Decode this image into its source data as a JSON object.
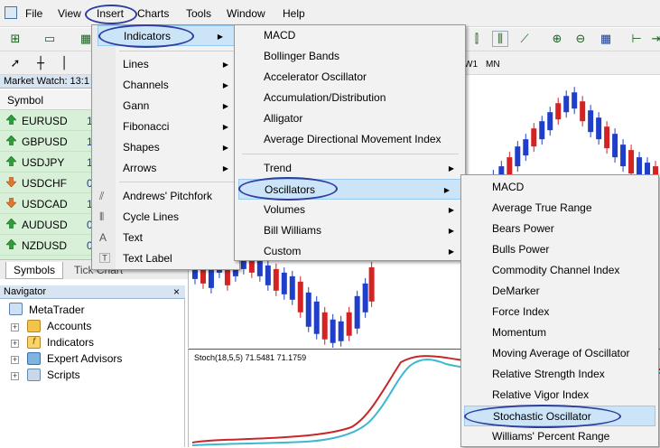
{
  "menubar": {
    "items": [
      "File",
      "View",
      "Insert",
      "Charts",
      "Tools",
      "Window",
      "Help"
    ]
  },
  "timeframes": [
    "W1",
    "MN"
  ],
  "market_watch": {
    "title": "Market Watch: 13:1",
    "column_symbol": "Symbol",
    "rows": [
      {
        "symbol": "EURUSD",
        "bid": "1",
        "dir": "up"
      },
      {
        "symbol": "GBPUSD",
        "bid": "1",
        "dir": "up"
      },
      {
        "symbol": "USDJPY",
        "bid": "1",
        "dir": "up"
      },
      {
        "symbol": "USDCHF",
        "bid": "0",
        "dir": "down"
      },
      {
        "symbol": "USDCAD",
        "bid": "1",
        "dir": "down"
      },
      {
        "symbol": "AUDUSD",
        "bid": "0",
        "dir": "up"
      },
      {
        "symbol": "NZDUSD",
        "bid": "0",
        "dir": "up"
      },
      {
        "symbol": "EURJPY",
        "bid": "1",
        "dir": "down"
      }
    ],
    "tabs": [
      "Symbols",
      "Tick Chart"
    ]
  },
  "navigator": {
    "title": "Navigator",
    "close": "×",
    "root": "MetaTrader",
    "items": [
      "Accounts",
      "Indicators",
      "Expert Advisors",
      "Scripts"
    ]
  },
  "insert_menu": {
    "items": [
      {
        "label": "Indicators",
        "submenu": true
      },
      {
        "label": "Lines",
        "submenu": true
      },
      {
        "label": "Channels",
        "submenu": true
      },
      {
        "label": "Gann",
        "submenu": true
      },
      {
        "label": "Fibonacci",
        "submenu": true
      },
      {
        "label": "Shapes",
        "submenu": true
      },
      {
        "label": "Arrows",
        "submenu": true
      },
      {
        "label": "Andrews' Pitchfork",
        "submenu": false
      },
      {
        "label": "Cycle Lines",
        "submenu": false
      },
      {
        "label": "Text",
        "submenu": false
      },
      {
        "label": "Text Label",
        "submenu": false
      }
    ]
  },
  "indicators_menu": {
    "items": [
      {
        "label": "MACD",
        "submenu": false
      },
      {
        "label": "Bollinger Bands",
        "submenu": false
      },
      {
        "label": "Accelerator Oscillator",
        "submenu": false
      },
      {
        "label": "Accumulation/Distribution",
        "submenu": false
      },
      {
        "label": "Alligator",
        "submenu": false
      },
      {
        "label": "Average Directional Movement Index",
        "submenu": false
      },
      {
        "label": "Trend",
        "submenu": true
      },
      {
        "label": "Oscillators",
        "submenu": true
      },
      {
        "label": "Volumes",
        "submenu": true
      },
      {
        "label": "Bill Williams",
        "submenu": true
      },
      {
        "label": "Custom",
        "submenu": true
      }
    ]
  },
  "oscillators_menu": {
    "items": [
      "MACD",
      "Average True Range",
      "Bears Power",
      "Bulls Power",
      "Commodity Channel Index",
      "DeMarker",
      "Force Index",
      "Momentum",
      "Moving Average of Oscillator",
      "Relative Strength Index",
      "Relative Vigor Index",
      "Stochastic Oscillator",
      "Williams' Percent Range"
    ],
    "selected": "Stochastic Oscillator"
  },
  "oscillator_panel": {
    "label": "Stoch(18,5,5) 71.5481 71.1759"
  },
  "colors": {
    "bull": "#1f3ec9",
    "bear": "#d42323",
    "stoch_main": "#3cb8d0",
    "stoch_signal": "#c62828",
    "highlight": "#cce4f7",
    "annotation": "#2e3e9e"
  }
}
